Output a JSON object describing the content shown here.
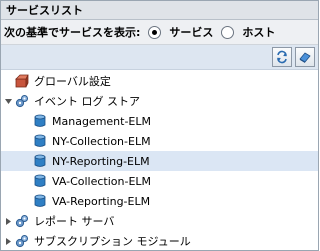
{
  "panel": {
    "title": "サービスリスト"
  },
  "filter": {
    "prompt": "次の基準でサービスを表示:",
    "options": [
      {
        "label": "サービス",
        "selected": true
      },
      {
        "label": "ホスト",
        "selected": false
      }
    ]
  },
  "toolbar": {
    "buttons": [
      {
        "icon": "refresh-icon"
      },
      {
        "icon": "eraser-icon"
      }
    ]
  },
  "tree": {
    "items": [
      {
        "label": "グローバル設定",
        "icon": "global-settings-icon",
        "expandable": false
      },
      {
        "label": "イベント ログ ストア",
        "icon": "gears-icon",
        "expandable": true,
        "expanded": true
      },
      {
        "label": "Management-ELM",
        "icon": "cylinder-icon"
      },
      {
        "label": "NY-Collection-ELM",
        "icon": "cylinder-icon"
      },
      {
        "label": "NY-Reporting-ELM",
        "icon": "cylinder-icon",
        "selected": true
      },
      {
        "label": "VA-Collection-ELM",
        "icon": "cylinder-icon"
      },
      {
        "label": "VA-Reporting-ELM",
        "icon": "cylinder-icon"
      },
      {
        "label": "レポート サーバ",
        "icon": "gears-icon",
        "expandable": true,
        "expanded": false
      },
      {
        "label": "サブスクリプション モジュール",
        "icon": "gears-icon",
        "expandable": true,
        "expanded": false
      }
    ]
  },
  "colors": {
    "selection": "#dbe6f4",
    "toolbar": "#dde6f1",
    "cylinder": "#2f7fc4"
  }
}
